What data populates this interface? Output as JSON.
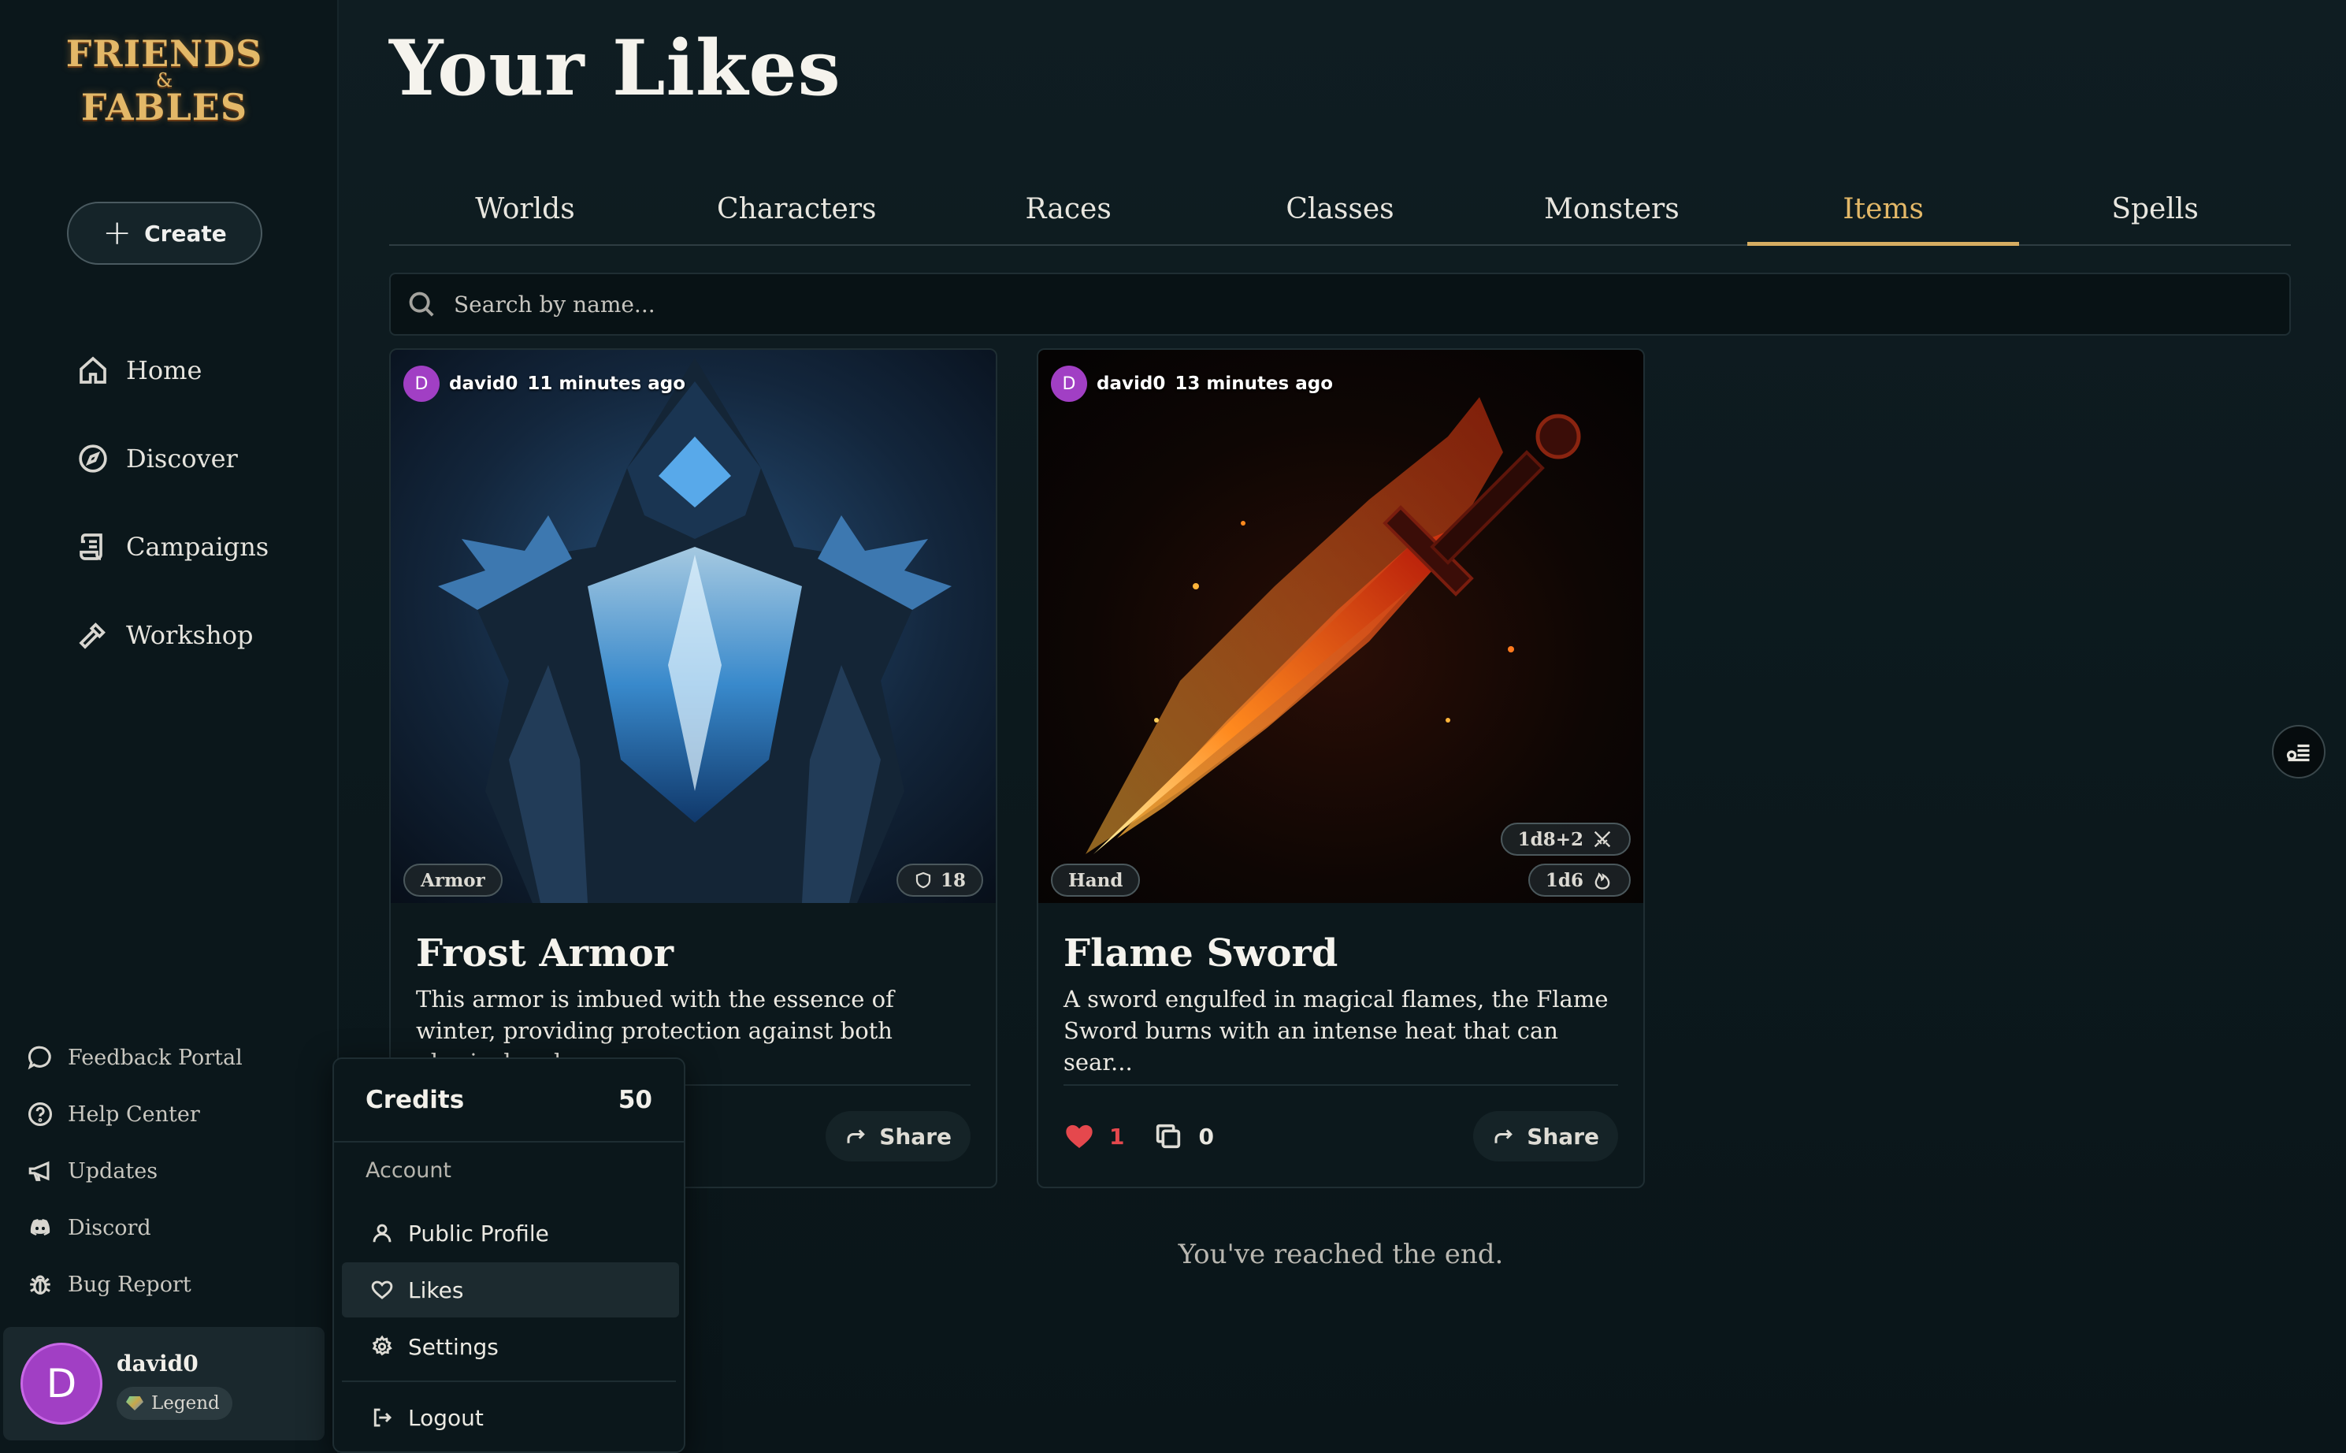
{
  "logo": {
    "line1": "FRIENDS",
    "line2": "&",
    "line3": "FABLES"
  },
  "sidebar": {
    "create_label": "Create",
    "nav": [
      {
        "label": "Home",
        "icon": "home-icon"
      },
      {
        "label": "Discover",
        "icon": "compass-icon"
      },
      {
        "label": "Campaigns",
        "icon": "scroll-icon"
      },
      {
        "label": "Workshop",
        "icon": "hammer-icon"
      }
    ],
    "utility": [
      {
        "label": "Feedback Portal",
        "icon": "chat-bubble-icon"
      },
      {
        "label": "Help Center",
        "icon": "question-circle-icon"
      },
      {
        "label": "Updates",
        "icon": "megaphone-icon"
      },
      {
        "label": "Discord",
        "icon": "discord-icon"
      },
      {
        "label": "Bug Report",
        "icon": "bug-icon"
      }
    ],
    "user": {
      "avatar_letter": "D",
      "name": "david0",
      "badge": "Legend"
    }
  },
  "main": {
    "title": "Your Likes",
    "tabs": [
      "Worlds",
      "Characters",
      "Races",
      "Classes",
      "Monsters",
      "Items",
      "Spells"
    ],
    "active_tab": "Items",
    "search_placeholder": "Search by name...",
    "end_text": "You've reached the end."
  },
  "cards": [
    {
      "author_letter": "D",
      "author": "david0",
      "time": "11 minutes ago",
      "category": "Armor",
      "armor_value": "18",
      "title": "Frost Armor",
      "description": "This armor is imbued with the essence of winter, providing protection against both physical and...",
      "share_label": "Share"
    },
    {
      "author_letter": "D",
      "author": "david0",
      "time": "13 minutes ago",
      "category": "Hand",
      "damage1": "1d8+2",
      "damage2": "1d6",
      "title": "Flame Sword",
      "description": "A sword engulfed in magical flames, the Flame Sword burns with an intense heat that can sear...",
      "likes": "1",
      "copies": "0",
      "share_label": "Share"
    }
  ],
  "account_menu": {
    "credits_label": "Credits",
    "credits_value": "50",
    "section_label": "Account",
    "items": [
      {
        "label": "Public Profile",
        "icon": "user-icon"
      },
      {
        "label": "Likes",
        "icon": "heart-outline-icon"
      },
      {
        "label": "Settings",
        "icon": "gear-icon"
      },
      {
        "label": "Logout",
        "icon": "logout-icon"
      }
    ],
    "active_item": "Likes"
  },
  "colors": {
    "accent_gold": "#d6ad62",
    "avatar_purple": "#a13fc4",
    "like_red": "#e5484d",
    "background": "#0c191d"
  }
}
